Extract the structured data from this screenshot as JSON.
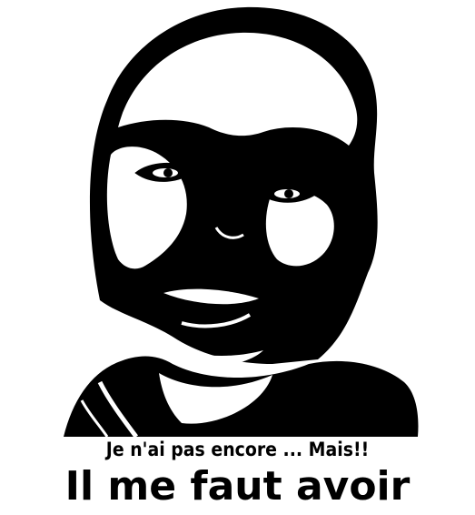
{
  "poster": {
    "image": {
      "subject": "high-contrast black and white portrait",
      "colors": {
        "ink": "#000000",
        "paper": "#ffffff"
      }
    },
    "caption": {
      "line1": "Je n'ai pas encore ... Mais!!",
      "line2": "Il me faut avoir"
    }
  }
}
